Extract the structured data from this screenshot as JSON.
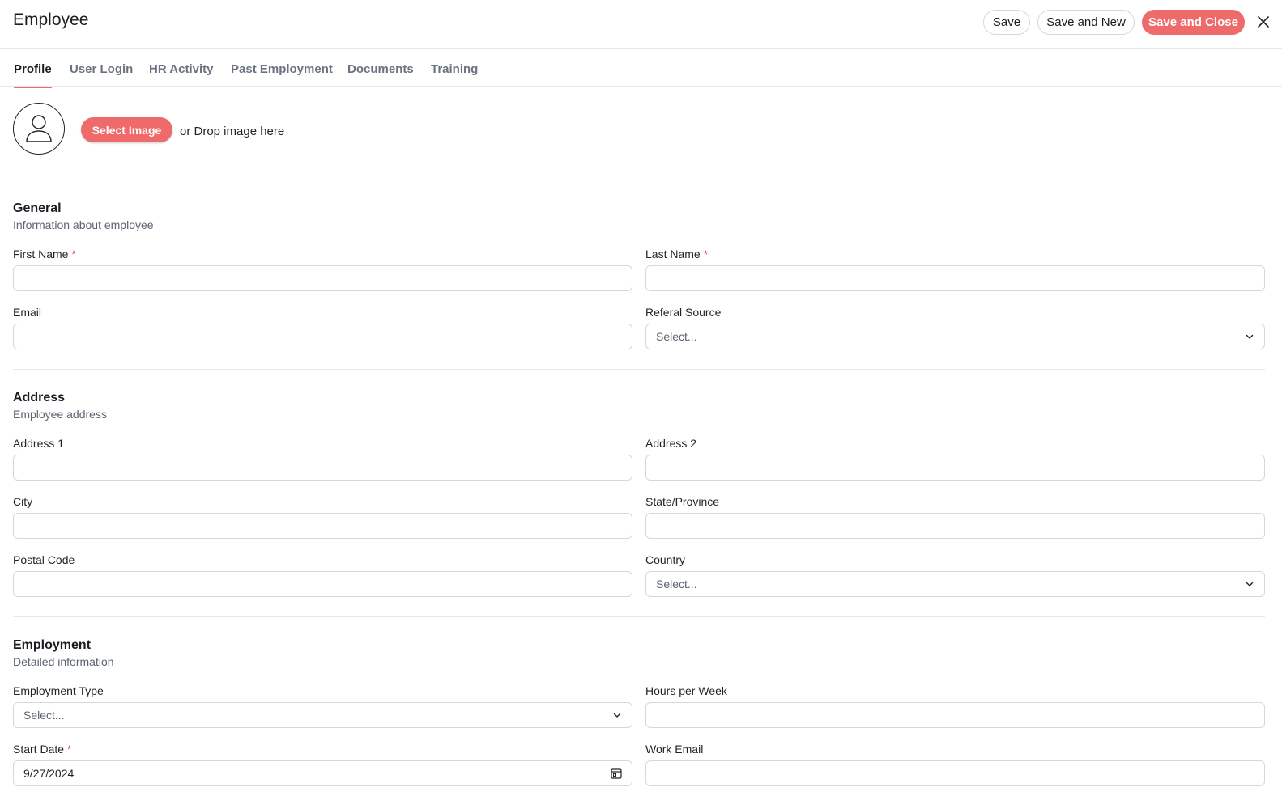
{
  "header": {
    "title": "Employee",
    "save_label": "Save",
    "save_new_label": "Save and New",
    "save_close_label": "Save and Close",
    "close_icon": "close-icon",
    "accent_color": "#ef6a6a"
  },
  "tabs": [
    {
      "label": "Profile",
      "active": true
    },
    {
      "label": "User Login",
      "active": false
    },
    {
      "label": "HR Activity",
      "active": false
    },
    {
      "label": "Past Employment",
      "active": false
    },
    {
      "label": "Documents",
      "active": false
    },
    {
      "label": "Training",
      "active": false
    }
  ],
  "image_upload": {
    "avatar_icon": "user-icon",
    "button_label": "Select Image",
    "drop_text": "or Drop image here"
  },
  "general": {
    "title": "General",
    "subtitle": "Information about employee",
    "first_name": {
      "label": "First Name",
      "required": "*",
      "value": ""
    },
    "last_name": {
      "label": "Last Name",
      "required": "*",
      "value": ""
    },
    "email": {
      "label": "Email",
      "value": ""
    },
    "referral_source": {
      "label": "Referal Source",
      "placeholder": "Select..."
    }
  },
  "address": {
    "title": "Address",
    "subtitle": "Employee address",
    "address1": {
      "label": "Address 1",
      "value": ""
    },
    "address2": {
      "label": "Address 2",
      "value": ""
    },
    "city": {
      "label": "City",
      "value": ""
    },
    "state": {
      "label": "State/Province",
      "value": ""
    },
    "postal_code": {
      "label": "Postal Code",
      "value": ""
    },
    "country": {
      "label": "Country",
      "placeholder": "Select..."
    }
  },
  "employment": {
    "title": "Employment",
    "subtitle": "Detailed information",
    "employment_type": {
      "label": "Employment Type",
      "placeholder": "Select..."
    },
    "hours_per_week": {
      "label": "Hours per Week",
      "value": ""
    },
    "start_date": {
      "label": "Start Date",
      "required": "*",
      "value": "9/27/2024"
    },
    "work_email": {
      "label": "Work Email",
      "value": ""
    }
  }
}
